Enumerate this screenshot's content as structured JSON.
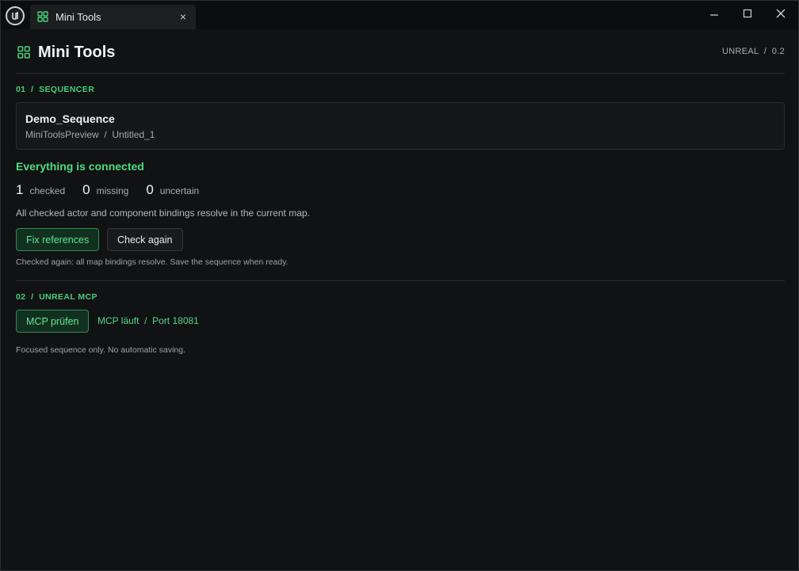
{
  "window": {
    "tab_title": "Mini Tools",
    "tab_close": "×"
  },
  "header": {
    "title": "Mini Tools",
    "version": "UNREAL  /  0.2"
  },
  "sequencer": {
    "section_label": "01  /  SEQUENCER",
    "sequence_name": "Demo_Sequence",
    "sequence_path": "MiniToolsPreview  /  Untitled_1",
    "status_title": "Everything is connected",
    "stats": {
      "checked_count": "1",
      "checked_label": "checked",
      "missing_count": "0",
      "missing_label": "missing",
      "uncertain_count": "0",
      "uncertain_label": "uncertain"
    },
    "status_description": "All checked actor and component bindings resolve in the current map.",
    "fix_button": "Fix references",
    "check_button": "Check again",
    "note": "Checked again: all map bindings resolve. Save the sequence when ready."
  },
  "mcp": {
    "section_label": "02  /  UNREAL MCP",
    "check_button": "MCP prüfen",
    "status": "MCP läuft  /  Port 18081",
    "note": "Focused sequence only. No automatic saving."
  },
  "colors": {
    "accent": "#46d07a",
    "background": "#111214",
    "card": "#15171a"
  },
  "icons": {
    "app": "grid-icon",
    "logo": "unreal-logo-icon"
  }
}
